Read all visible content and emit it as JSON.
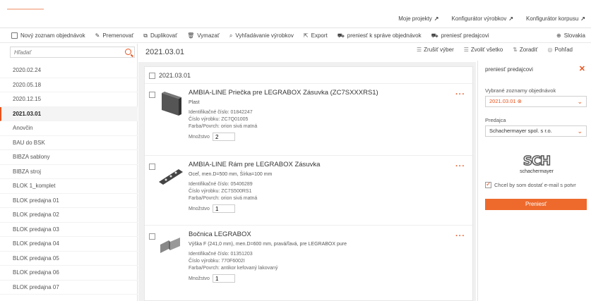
{
  "topnav": {
    "links": [
      "Moje projekty",
      "Konfigurátor výrobkov",
      "Konfigurátor korpusu"
    ]
  },
  "toolbar": {
    "items": [
      "Nový zoznam objednávok",
      "Premenovať",
      "Duplikovať",
      "Vymazať",
      "Vyhľadávanie výrobkov",
      "Export",
      "preniesť k správe objednávok",
      "preniesť predajcovi"
    ],
    "language": "Slovakia"
  },
  "sidebar": {
    "search_placeholder": "Hľadať",
    "items": [
      "2020.02.24",
      "2020.05.18",
      "2020.12.15",
      "2021.03.01",
      "Anovčin",
      "BAU do BSK",
      "BIBZA sablony",
      "BIBZA stroj",
      "BLOK 1_komplet",
      "BLOK predajna 01",
      "BLOK predajna 02",
      "BLOK predajna 03",
      "BLOK predajna 04",
      "BLOK predajna 05",
      "BLOK predajna 06",
      "BLOK predajna 07"
    ],
    "active_index": 3
  },
  "main": {
    "title": "2021.03.01",
    "actions": [
      "Zrušiť výber",
      "Zvoliť všetko",
      "Zoradiť",
      "Pohľad"
    ],
    "group_label": "2021.03.01",
    "quantity_label": "Množstvo",
    "products": [
      {
        "title": "AMBIA-LINE Priečka pre LEGRABOX Zásuvka (ZC7SXXXRS1)",
        "subtitle": "Plast",
        "meta": [
          "Identifikačné číslo: 01842247",
          "Číslo výrobku: ZC7Q01005",
          "Farba/Povrch: orion sivá matná"
        ],
        "quantity": "2"
      },
      {
        "title": "AMBIA-LINE Rám pre LEGRABOX Zásuvka",
        "subtitle": "Oceľ, men.D=500 mm, Šírka=100 mm",
        "meta": [
          "Identifikačné číslo: 05406289",
          "Číslo výrobku: ZC7S500RS1",
          "Farba/Povrch: orion sivá matná"
        ],
        "quantity": "1"
      },
      {
        "title": "Bočnica LEGRABOX",
        "subtitle": "Výška F (241,0 mm), men.D=600 mm, pravá/ľavá, pre LEGRABOX pure",
        "meta": [
          "Identifikačné číslo: 01351203",
          "Číslo výrobku: 770F6002I",
          "Farba/Povrch: antikor kefovaný lakovaný"
        ],
        "quantity": "1"
      }
    ]
  },
  "rightpanel": {
    "title": "preniesť predajcovi",
    "lists_label": "Vybrané zoznamy objednávok",
    "lists_value": "2021.03.01",
    "dealer_label": "Predajca",
    "dealer_value": "Schachermayer spol. s r.o.",
    "logo_text": "schachermayer",
    "email_label": "Chcel by som dostať e-mail s potvr",
    "submit_label": "Preniesť"
  },
  "colors": {
    "accent": "#ee6a2c"
  }
}
